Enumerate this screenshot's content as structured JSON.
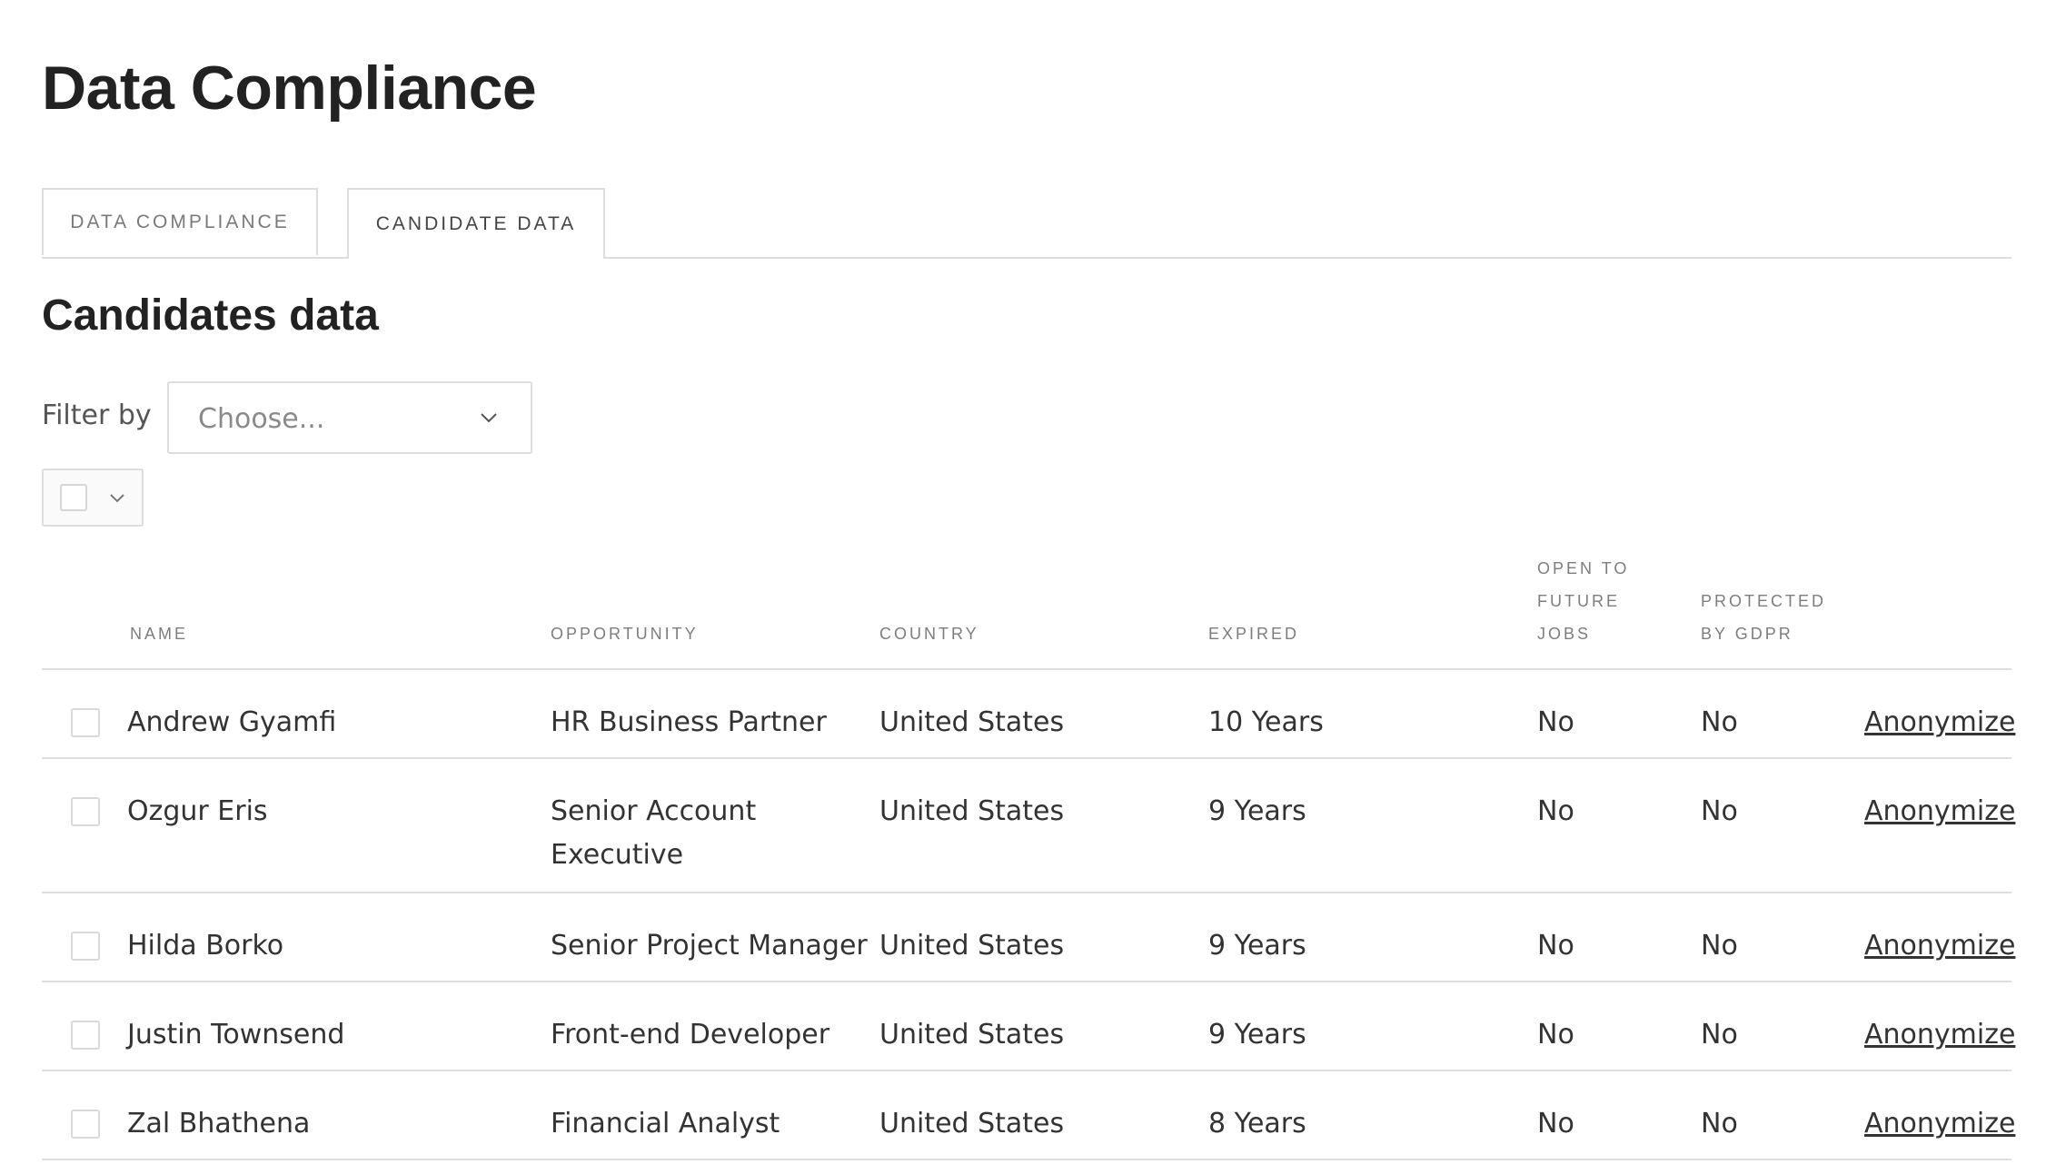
{
  "page": {
    "title": "Data Compliance"
  },
  "tabs": [
    {
      "label": "DATA COMPLIANCE"
    },
    {
      "label": "CANDIDATE DATA"
    }
  ],
  "section": {
    "title": "Candidates data"
  },
  "filter": {
    "label": "Filter by",
    "placeholder": "Choose..."
  },
  "table": {
    "headers": {
      "name": "NAME",
      "opportunity": "OPPORTUNITY",
      "country": "COUNTRY",
      "expired": "EXPIRED",
      "open_to_future_jobs": "OPEN TO FUTURE JOBS",
      "protected_by_gdpr": "PROTECTED BY GDPR"
    },
    "rows": [
      {
        "name": "Andrew Gyamfi",
        "opportunity": "HR Business Partner",
        "country": "United States",
        "expired": "10 Years",
        "open": "No",
        "gdpr": "No",
        "action": "Anonymize"
      },
      {
        "name": "Ozgur Eris",
        "opportunity": "Senior Account Executive",
        "country": "United States",
        "expired": "9 Years",
        "open": "No",
        "gdpr": "No",
        "action": "Anonymize"
      },
      {
        "name": "Hilda Borko",
        "opportunity": "Senior Project Manager",
        "country": "United States",
        "expired": "9 Years",
        "open": "No",
        "gdpr": "No",
        "action": "Anonymize"
      },
      {
        "name": "Justin Townsend",
        "opportunity": "Front-end Developer",
        "country": "United States",
        "expired": "9 Years",
        "open": "No",
        "gdpr": "No",
        "action": "Anonymize"
      },
      {
        "name": "Zal Bhathena",
        "opportunity": "Financial Analyst",
        "country": "United States",
        "expired": "8 Years",
        "open": "No",
        "gdpr": "No",
        "action": "Anonymize"
      }
    ]
  }
}
